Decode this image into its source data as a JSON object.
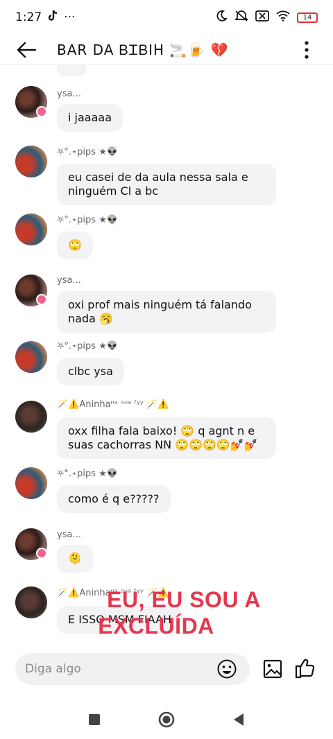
{
  "status_bar": {
    "time": "1:27",
    "extra_glyph": "···",
    "battery_level": "14"
  },
  "header": {
    "title": "BAR DA ᏴᏆᏴIH 🚬🍺 💔"
  },
  "messages": [
    {
      "sender": "ysa...",
      "text": "i jaaaaa",
      "avatar": "ysa"
    },
    {
      "sender": "⛧°.⋆pips ★👽",
      "text": "eu casei de da aula nessa sala e ninguém Cl a bc",
      "avatar": "pips"
    },
    {
      "sender": "⛧°.⋆pips ★👽",
      "text": "🙄",
      "avatar": "pips"
    },
    {
      "sender": "ysa...",
      "text": "oxi prof mais ninguém tá falando nada 🥱",
      "avatar": "ysa"
    },
    {
      "sender": "⛧°.⋆pips ★👽",
      "text": "clbc ysa",
      "avatar": "pips"
    },
    {
      "sender": "🪄⚠️Aninhaⁿᵃ ˢᵘᵃ ᶠʸʸ 🪄⚠️",
      "text": "oxx filha fala baixo! 🙄 q agnt n e suas cachorras NN 🙄🙄🙄🙄💅💅",
      "avatar": "aninha"
    },
    {
      "sender": "⛧°.⋆pips ★👽",
      "text": "como é q e?????",
      "avatar": "pips"
    },
    {
      "sender": "ysa...",
      "text": "🫠",
      "avatar": "ysa"
    },
    {
      "sender": "🪄⚠️Aninhaⁿᵃ ˢᵘᵃ ᶠʸʸ 🪄⚠️",
      "text": "E ISSO MSM FIAAH",
      "avatar": "aninha"
    }
  ],
  "overlay": {
    "line1": "EU, EU SOU A",
    "line2": "EXCLUÍDA"
  },
  "composer": {
    "placeholder": "Diga algo"
  },
  "icons": {
    "back": "arrow-left-icon",
    "more": "more-vertical-icon",
    "emoji": "emoji-icon",
    "image": "image-icon",
    "like": "thumbs-up-icon",
    "nav_recent": "square-icon",
    "nav_home": "circle-icon",
    "nav_back": "triangle-back-icon"
  },
  "colors": {
    "overlay_text": "#e5374f",
    "bubble_bg": "#f3f3f5",
    "badge": "#f1638c",
    "battery_low": "#dd3333"
  }
}
